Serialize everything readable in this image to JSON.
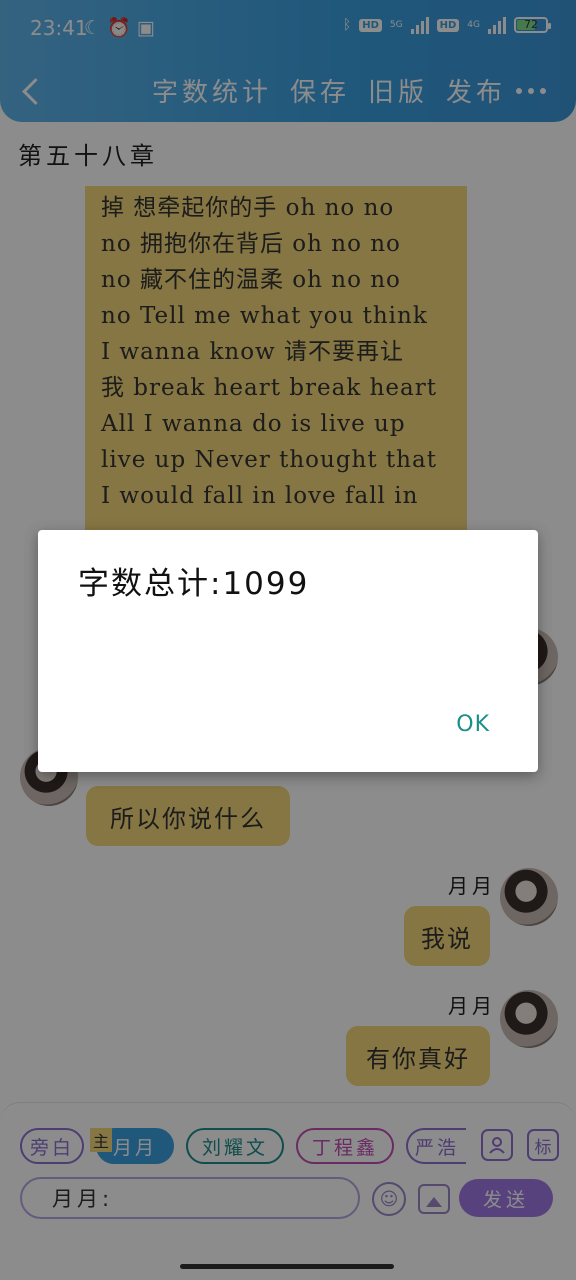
{
  "status_bar": {
    "time": "23:41",
    "left_icons": [
      "moon-icon",
      "alarm-icon",
      "notification-icon"
    ],
    "network_1": "5G",
    "network_2": "4G",
    "hd": "HD",
    "battery": "72"
  },
  "header": {
    "actions": [
      "字数统计",
      "保存",
      "旧版",
      "发布"
    ]
  },
  "chapter_title": "第五十八章",
  "lyrics": [
    "掉  想牵起你的手 oh no no",
    "no  拥抱你在背后 oh no no",
    "no  藏不住的温柔 oh no no",
    "no  Tell me what you think",
    "I wanna know  请不要再让",
    "我 break heart break heart",
    "All I wanna do is live up",
    "live up  Never thought that",
    "I would fall in love fall in"
  ],
  "chat": {
    "left_message": "所以你说什么",
    "right_messages": [
      {
        "name": "月月",
        "text": "我说"
      },
      {
        "name": "月月",
        "text": "有你真好"
      }
    ]
  },
  "composer": {
    "roles": [
      {
        "label": "旁白",
        "color": "#8f6fd0"
      },
      {
        "label": "月月",
        "color": "#3aa0e0"
      },
      {
        "label": "刘耀文",
        "color": "#1c8f8a"
      },
      {
        "label": "丁程鑫",
        "color": "#c24fb5"
      },
      {
        "label": "严浩",
        "color": "#8f6fd0"
      }
    ],
    "main_badge": "主",
    "tag_label": "标",
    "input_prefix": "月月:",
    "send_label": "发送"
  },
  "dialog": {
    "message": "字数总计:1099",
    "ok_label": "OK"
  }
}
